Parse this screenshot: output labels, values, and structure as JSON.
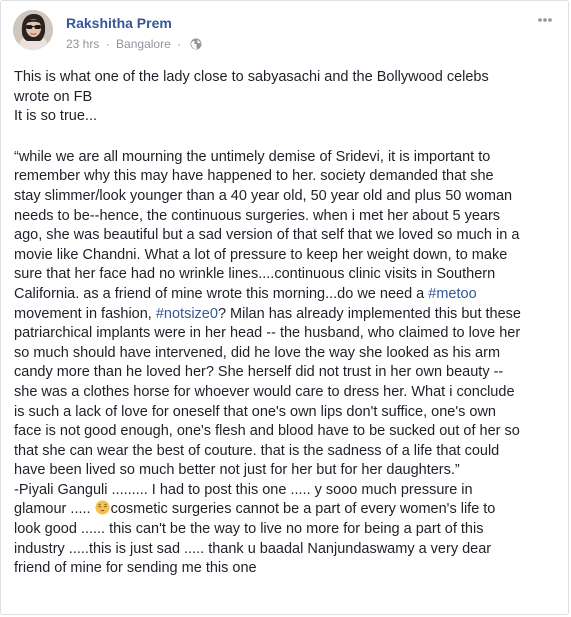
{
  "post": {
    "author": "Rakshitha Prem",
    "time": "23 hrs",
    "separator": "·",
    "location": "Bangalore",
    "privacy_icon": "globe-icon",
    "more_icon": "more-options-icon",
    "avatar_icon": "profile-photo"
  },
  "body": {
    "intro": [
      "This is what one of the lady close to sabyasachi and the Bollywood celebs",
      "wrote on FB",
      "It is so true..."
    ],
    "quote": {
      "lines_before_tags": [
        "“while we are all mourning the untimely demise of Sridevi, it is important to",
        "remember why this may have happened to her. society demanded that she",
        "stay slimmer/look younger than a 40 year old, 50 year old and plus 50 woman",
        "needs to be--hence, the continuous surgeries. when i met her about 5 years",
        "ago, she was beautiful but a sad version of that self that we loved so much in a",
        "movie like Chandni. What a lot of pressure to keep her weight down, to make",
        "sure that her face had no wrinkle lines....continuous clinic visits in Southern",
        "California. as a friend of mine wrote this morning...do we need a "
      ],
      "hashtag_metoo": "#metoo",
      "line_tags_prefix": "movement in fashion, ",
      "hashtag_notsize0": "#notsize0",
      "line_tags_suffix": "? Milan has already implemented this but these",
      "lines_after_tags": [
        "patriarchical implants were in her head -- the husband, who claimed to love her",
        "so much should have intervened, did he love the way she looked as his arm",
        "candy more than he loved her? She herself did not trust in her own beauty --",
        "she was a clothes horse for whoever would care to dress her. What i conclude",
        "is such a lack of love for oneself that one's own lips don't suffice, one's own",
        "face is not good enough, one's flesh and blood have to be sucked out of her so",
        "that she can wear the best of couture. that is the sadness of a life that could",
        "have been lived so much better not just for her but for her daughters.”"
      ]
    },
    "signoff": {
      "line1": "-Piyali Ganguli ......... I had to post this one ..... y sooo much pressure in",
      "line2_prefix": "glamour ..... ",
      "emoji": "pensive-face-emoji",
      "line2_suffix": "cosmetic surgeries cannot be a part of every women's life to",
      "lines_rest": [
        "look good ...... this can't be the way to live no more for being a part of this",
        "industry .....this is just sad ..... thank u baadal Nanjundaswamy a very dear",
        "friend of mine for sending me this one"
      ]
    }
  },
  "colors": {
    "author": "#365899",
    "meta": "#90949c",
    "text": "#1d2129",
    "border": "#dddfe2"
  }
}
